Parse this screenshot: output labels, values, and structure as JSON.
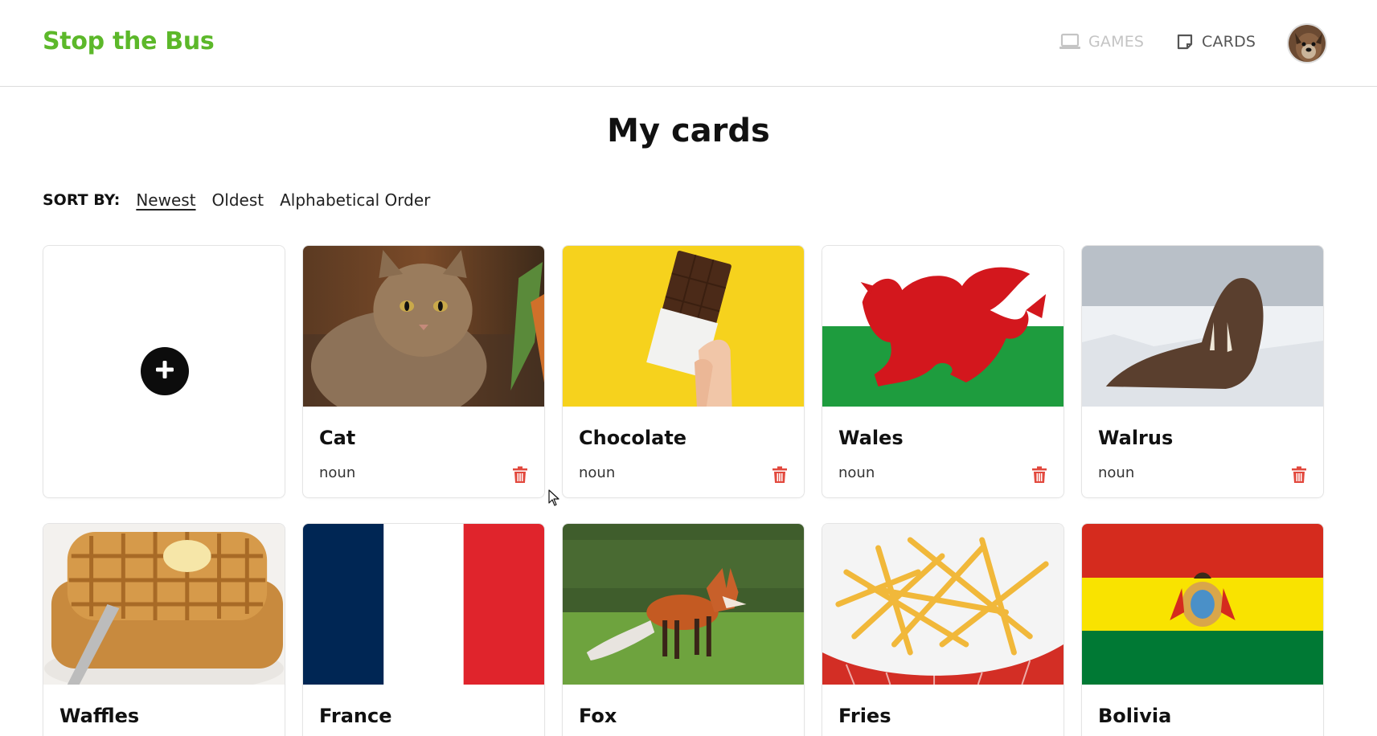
{
  "app": {
    "brand": "Stop the Bus"
  },
  "nav": {
    "games_label": "GAMES",
    "cards_label": "CARDS",
    "games_icon": "laptop-icon",
    "cards_icon": "card-icon"
  },
  "page": {
    "title": "My cards"
  },
  "sort": {
    "label": "SORT BY:",
    "options": [
      "Newest",
      "Oldest",
      "Alphabetical Order"
    ],
    "selected": "Newest"
  },
  "add_card": {
    "icon": "plus-icon"
  },
  "cards": [
    {
      "title": "Cat",
      "type": "noun"
    },
    {
      "title": "Chocolate",
      "type": "noun"
    },
    {
      "title": "Wales",
      "type": "noun"
    },
    {
      "title": "Walrus",
      "type": "noun"
    },
    {
      "title": "Waffles",
      "type": ""
    },
    {
      "title": "France",
      "type": ""
    },
    {
      "title": "Fox",
      "type": ""
    },
    {
      "title": "Fries",
      "type": ""
    },
    {
      "title": "Bolivia",
      "type": ""
    }
  ],
  "colors": {
    "brand": "#5cb82a",
    "trash": "#e2483d",
    "nav_inactive": "#c4c4c4",
    "nav_active": "#555555"
  }
}
